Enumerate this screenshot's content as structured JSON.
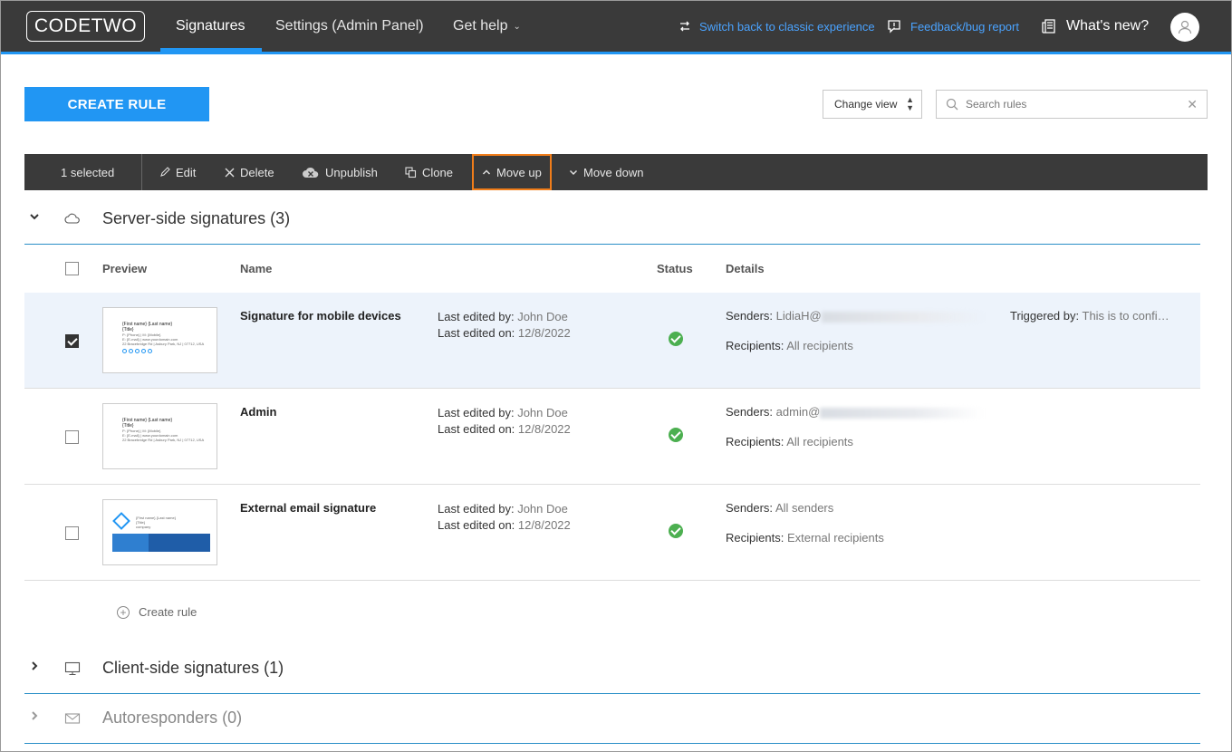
{
  "app": {
    "logo": "CODETWO"
  },
  "nav": {
    "tabs": [
      {
        "label": "Signatures",
        "active": true
      },
      {
        "label": "Settings (Admin Panel)"
      },
      {
        "label": "Get help"
      }
    ],
    "switch_label": "Switch back to classic experience",
    "feedback_label": "Feedback/bug report",
    "whats_new_label": "What's new?"
  },
  "actions": {
    "create_rule": "CREATE RULE",
    "change_view": "Change view",
    "search_placeholder": "Search rules"
  },
  "toolbar": {
    "selected": "1 selected",
    "edit": "Edit",
    "delete": "Delete",
    "unpublish": "Unpublish",
    "clone": "Clone",
    "move_up": "Move up",
    "move_down": "Move down"
  },
  "sections": {
    "server": "Server-side signatures (3)",
    "client": "Client-side signatures (1)",
    "auto": "Autoresponders (0)"
  },
  "table": {
    "headers": {
      "preview": "Preview",
      "name": "Name",
      "status": "Status",
      "details": "Details"
    },
    "last_edited_by_label": "Last edited by:",
    "last_edited_on_label": "Last edited on:",
    "senders_label": "Senders:",
    "recipients_label": "Recipients:",
    "triggered_label": "Triggered by:",
    "rows": [
      {
        "name": "Signature for mobile devices",
        "edited_by": "John Doe",
        "edited_on": "12/8/2022",
        "senders": "LidiaH@",
        "recipients": "All recipients",
        "triggered": "This is to confi…",
        "checked": true
      },
      {
        "name": "Admin",
        "edited_by": "John Doe",
        "edited_on": "12/8/2022",
        "senders": "admin@",
        "recipients": "All recipients"
      },
      {
        "name": "External email signature",
        "edited_by": "John Doe",
        "edited_on": "12/8/2022",
        "senders": "All senders",
        "recipients": "External recipients"
      }
    ],
    "create_rule_link": "Create rule"
  },
  "thumb": {
    "name_line": "{First name} {Last name}",
    "title_line": "{Title}",
    "phone_line": "P: {Phone} | M: {Mobile}",
    "email_line": "E: {E-mail} | www.yourdomain.com",
    "address_line": "22 Bracebridge Rd | Asbury Park, NJ | 07712, USA",
    "company": "company"
  },
  "colors": {
    "accent": "#2196f3",
    "topbar": "#3a3a3a",
    "highlight": "#f07d1a",
    "status_ok": "#4caf50"
  }
}
